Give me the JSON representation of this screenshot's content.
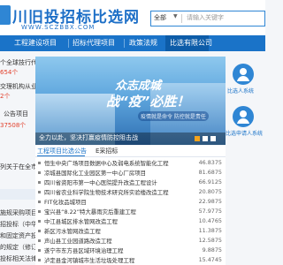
{
  "header": {
    "logo_title": "川旧投招标比选网",
    "logo_url": "WWW.SCZBBX.COM",
    "search_select": "全部",
    "search_placeholder": "请输入关键字"
  },
  "nav": {
    "items": [
      "工程建设项目",
      "招标代理项目",
      "政策法规",
      "比选有限公司"
    ],
    "active_index": 3
  },
  "left": {
    "lines": [
      {
        "text": "个全球技行代理机",
        "style": "dark"
      },
      {
        "text": "654个",
        "style": "red"
      },
      {
        "text": "交理机构从业人员",
        "style": "dark"
      },
      {
        "text": "2个",
        "style": "red"
      },
      {
        "text": "公告项目",
        "style": "dark"
      },
      {
        "text": "37508个",
        "style": "red"
      }
    ],
    "lower_lines": [
      {
        "text": "列关于在全市",
        "style": "dark"
      },
      {
        "text": "施规采购项目",
        "style": "dark"
      },
      {
        "text": "招投标（中华",
        "style": "dark"
      },
      {
        "text": "和固定资产投",
        "style": "dark"
      },
      {
        "text": "的规定（修订",
        "style": "dark"
      },
      {
        "text": "投标相关法律",
        "style": "dark"
      }
    ]
  },
  "banner": {
    "line1": "众志成城",
    "line2": "战“疫”必胜！",
    "sub": "疫情就是命令 防控就是责任",
    "caption": "全力以赴，坚决打赢疫情防控阻击战"
  },
  "right": {
    "items": [
      {
        "label": "比选人系统"
      },
      {
        "label": "比选申请人系统"
      }
    ]
  },
  "announcements": {
    "tab_active": "工程项目比选公告",
    "tab_second": "E采招标",
    "rows": [
      {
        "title": "恒生中央广场项目数据中心及弱电系统智能化工程",
        "num": "46.8375"
      },
      {
        "title": "凉城县国际化工业园区第一中心厂房项目",
        "num": "81.6875"
      },
      {
        "title": "四川省资阳市第一中心医院提升改造工程设计",
        "num": "66.9125"
      },
      {
        "title": "四川省农业科学院生物技术研究所实验楼改造工程",
        "num": "20.8075"
      },
      {
        "title": "FIT化妆品城项目",
        "num": "22.9875"
      },
      {
        "title": "宝兴县“8.22”特大暴雨灾后重建工程",
        "num": "57.9775"
      },
      {
        "title": "中江县城区排水管网改造工程",
        "num": "10.4765"
      },
      {
        "title": "新区污水管网改造工程",
        "num": "11.3875"
      },
      {
        "title": "声山县工业园道路改造工程",
        "num": "12.5875"
      },
      {
        "title": "遂宁市东方县区域环境治理工程",
        "num": "9.8875"
      },
      {
        "title": "泸定县金河镇城市生活垃圾处理工程",
        "num": "15.4745"
      }
    ]
  }
}
